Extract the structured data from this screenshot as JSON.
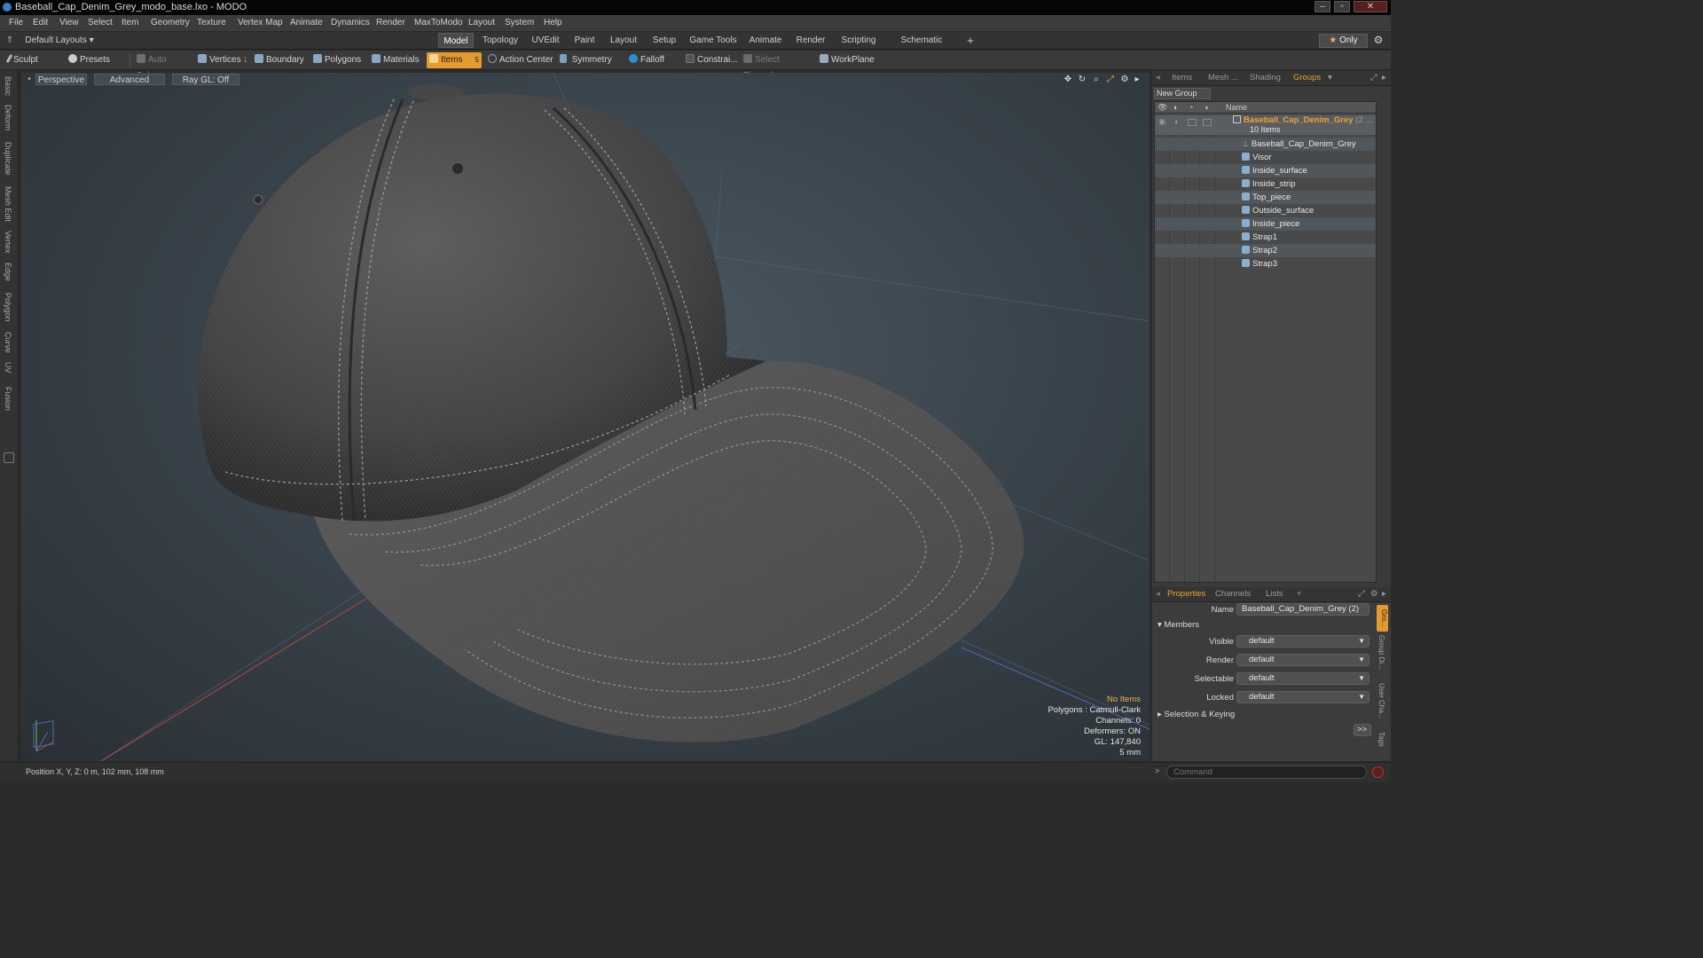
{
  "window": {
    "title": "Baseball_Cap_Denim_Grey_modo_base.lxo - MODO"
  },
  "menu": [
    "File",
    "Edit",
    "View",
    "Select",
    "Item",
    "Geometry",
    "Texture",
    "Vertex Map",
    "Animate",
    "Dynamics",
    "Render",
    "MaxToModo",
    "Layout",
    "System",
    "Help"
  ],
  "layout_selector": "Default Layouts",
  "layout_tabs": [
    "Model",
    "Topology",
    "UVEdit",
    "Paint",
    "Layout",
    "Setup",
    "Game Tools",
    "Animate",
    "Render",
    "Scripting",
    "Schematic Fusion"
  ],
  "active_layout_tab": "Model",
  "only_button": "Only",
  "toolbar": {
    "sculpt": "Sculpt",
    "presets": "Presets",
    "auto_select": "Auto Select",
    "vertices": "Vertices",
    "vertices_count": "1",
    "boundary": "Boundary",
    "polygons": "Polygons",
    "materials": "Materials",
    "items": "Items",
    "items_count": "5",
    "action_center": "Action Center",
    "symmetry": "Symmetry",
    "falloff": "Falloff",
    "constraints": "Constrai...",
    "select_through": "Select Through",
    "workplane": "WorkPlane"
  },
  "left_tabs": [
    "Basic",
    "Deform",
    "Duplicate",
    "Mesh Edit",
    "Vertex",
    "Edge",
    "Polygon",
    "Curve",
    "UV",
    "Fusion"
  ],
  "viewport": {
    "view": "Perspective",
    "shading": "Advanced",
    "raygl": "Ray GL: Off",
    "info": {
      "selection": "No Items",
      "polygons": "Polygons : Catmull-Clark",
      "channels": "Channels: 0",
      "deformers": "Deformers: ON",
      "gl": "GL: 147,840",
      "scale": "5 mm"
    }
  },
  "status": {
    "position": "Position X, Y, Z:  0 m, 102 mm, 108 mm",
    "command_placeholder": "Command"
  },
  "right_panel": {
    "tabs": [
      "Items",
      "Mesh ...",
      "Shading",
      "Groups"
    ],
    "active_tab": "Groups",
    "new_group": "New Group",
    "col_name": "Name",
    "group": {
      "name": "Baseball_Cap_Denim_Grey",
      "suffix": "(2 ...",
      "count": "10 Items"
    },
    "members": [
      "Baseball_Cap_Denim_Grey",
      "Visor",
      "Inside_surface",
      "Inside_strip",
      "Top_piece",
      "Outside_surface",
      "Inside_piece",
      "Strap1",
      "Strap2",
      "Strap3"
    ],
    "bottom_tabs": [
      "Properties",
      "Channels",
      "Lists",
      "+"
    ],
    "properties": {
      "name_label": "Name",
      "name_value": "Baseball_Cap_Denim_Grey (2)",
      "members_section": "Members",
      "visible_label": "Visible",
      "visible_value": "default",
      "render_label": "Render",
      "render_value": "default",
      "selectable_label": "Selectable",
      "selectable_value": "default",
      "locked_label": "Locked",
      "locked_value": "default",
      "selection_keying": "Selection & Keying",
      "expand": ">>"
    },
    "side_tabs": [
      "Gro...",
      "Group Di...",
      "User Cha...",
      "Tags"
    ]
  },
  "colors": {
    "accent": "#e59a2e",
    "viewport_bg": "#3a444c",
    "panel_bg": "#3a3a3a"
  }
}
